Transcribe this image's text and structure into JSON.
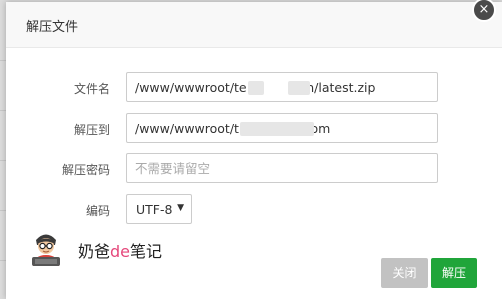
{
  "dialog": {
    "title": "解压文件",
    "close_icon": "×"
  },
  "form": {
    "file_name": {
      "label": "文件名",
      "value": "/www/wwwroot/te            om/latest.zip"
    },
    "extract_to": {
      "label": "解压到",
      "value": "/www/wwwroot/t                  om"
    },
    "password": {
      "label": "解压密码",
      "value": "",
      "placeholder": "不需要请留空"
    },
    "encoding": {
      "label": "编码",
      "selected": "UTF-8",
      "caret": "▼"
    }
  },
  "watermark": {
    "prefix": "奶爸",
    "accent": "de",
    "suffix": "笔记",
    "accent_color": "#e5487b"
  },
  "buttons": {
    "close_label": "关闭",
    "extract_label": "解压"
  },
  "colors": {
    "primary": "#20a53a",
    "disabled": "#c2c2c2"
  }
}
